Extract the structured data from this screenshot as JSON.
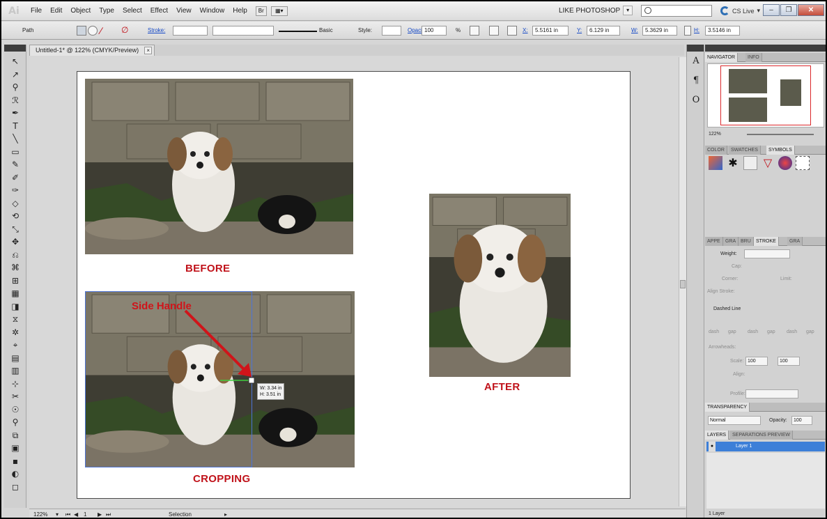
{
  "app": {
    "logo": "Ai",
    "menus": [
      "File",
      "Edit",
      "Object",
      "Type",
      "Select",
      "Effect",
      "View",
      "Window",
      "Help"
    ],
    "workspace": "LIKE PHOTOSHOP",
    "cslive": "CS Live"
  },
  "controlbar": {
    "selection_type": "Path",
    "stroke_label": "Stroke:",
    "brush_label": "Basic",
    "style_label": "Style:",
    "opacity_label": "Opacity:",
    "opacity_value": "100",
    "opacity_unit": "%",
    "x_label": "X:",
    "x_value": "5.5161 in",
    "y_label": "Y:",
    "y_value": "6.129 in",
    "w_label": "W:",
    "w_value": "5.3629 in",
    "h_label": "H:",
    "h_value": "3.5146 in"
  },
  "document": {
    "tab_title": "Untitled-1* @ 122% (CMYK/Preview)",
    "close": "×"
  },
  "artboard": {
    "before_caption": "BEFORE",
    "after_caption": "AFTER",
    "cropping_caption": "CROPPING",
    "annotation": "Side Handle",
    "tooltip_w": "W: 3.34 in",
    "tooltip_h": "H: 3.51 in"
  },
  "status": {
    "zoom": "122%",
    "page": "1",
    "mode": "Selection"
  },
  "panels": {
    "navigator_tab": "NAVIGATOR",
    "info_tab": "INFO",
    "nav_zoom": "122%",
    "color_tab": "COLOR",
    "swatches_tab": "SWATCHES",
    "symbols_tab": "SYMBOLS",
    "appearance_tab": "APPE",
    "graphic_tab": "GRA",
    "brush_tab": "BRU",
    "stroke_tab": "STROKE",
    "gradient_tab": "GRA",
    "weight_label": "Weight:",
    "cap_label": "Cap:",
    "corner_label": "Corner:",
    "limit_label": "Limit:",
    "align_stroke_label": "Align Stroke:",
    "dashed_line_label": "Dashed Line",
    "dash_labels": [
      "dash",
      "gap",
      "dash",
      "gap",
      "dash",
      "gap"
    ],
    "arrowheads_label": "Arrowheads:",
    "scale_label": "Scale:",
    "scale_1": "100",
    "scale_2": "100",
    "align_label": "Align:",
    "profile_label": "Profile:",
    "transparency_tab": "TRANSPARENCY",
    "blend_mode": "Normal",
    "t_opacity_label": "Opacity:",
    "t_opacity_value": "100",
    "layers_tab": "LAYERS",
    "separations_tab": "SEPARATIONS PREVIEW",
    "layer_name": "Layer 1",
    "layers_count": "1 Layer"
  },
  "colors": {
    "caption_red": "#c0121a",
    "arrow_red": "#d0141a",
    "selection_blue": "#4d74d6",
    "layer_highlight": "#3d7fd8"
  }
}
